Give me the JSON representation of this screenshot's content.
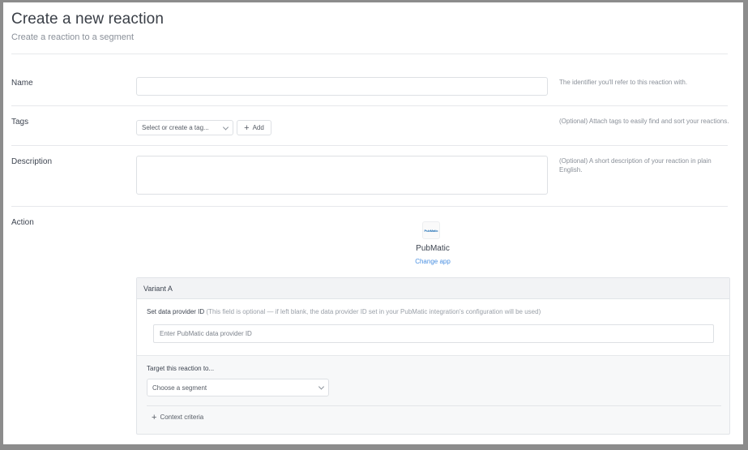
{
  "header": {
    "title": "Create a new reaction",
    "subtitle": "Create a reaction to a segment"
  },
  "form": {
    "name": {
      "label": "Name",
      "value": "",
      "help": "The identifier you'll refer to this reaction with."
    },
    "tags": {
      "label": "Tags",
      "select_placeholder": "Select or create a tag...",
      "add_label": "Add",
      "help": "(Optional) Attach tags to easily find and sort your reactions."
    },
    "description": {
      "label": "Description",
      "value": "",
      "help": "(Optional) A short description of your reaction in plain English."
    },
    "action": {
      "label": "Action",
      "app_logo_text": "PubMatic",
      "app_name": "PubMatic",
      "change_app_label": "Change app"
    }
  },
  "variant": {
    "title": "Variant A",
    "provider_label": "Set data provider ID",
    "provider_hint": "(This field is optional — if left blank, the data provider ID set in your PubMatic integration's configuration will be used)",
    "provider_placeholder": "Enter PubMatic data provider ID",
    "target_label": "Target this reaction to...",
    "segment_select": "Choose a segment",
    "context_criteria_label": "Context criteria"
  },
  "colors": {
    "accent_link": "#4a90e2",
    "text_primary": "#3d4450",
    "text_muted": "#8a9099"
  },
  "icons": {
    "add": "plus-icon",
    "dropdown": "chevron-down-icon",
    "context": "plus-icon"
  }
}
